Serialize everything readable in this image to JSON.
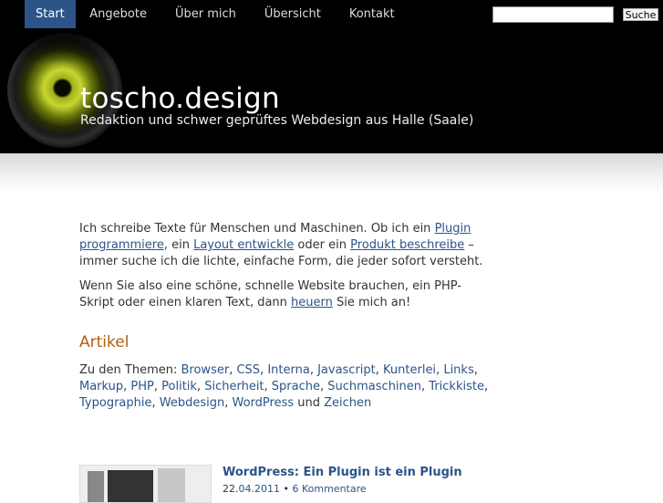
{
  "nav": {
    "items": [
      "Start",
      "Angebote",
      "Über mich",
      "Übersicht",
      "Kontakt"
    ]
  },
  "search": {
    "value": "",
    "button_label": "Suche"
  },
  "site": {
    "title": "toscho.design",
    "subtitle": "Redaktion und schwer geprüftes Webdesign aus Halle (Saale)"
  },
  "intro": {
    "p1_t1": "Ich schreibe Texte für Menschen und Maschinen. Ob ich ein ",
    "p1_l1": "Plugin programmiere",
    "p1_t2": ", ein ",
    "p1_l2": "Layout entwickle",
    "p1_t3": " oder ein ",
    "p1_l3": "Produkt beschreibe",
    "p1_t4": " – immer suche ich die lichte, einfache Form, die jeder sofort versteht.",
    "p2_t1": "Wenn Sie also eine schöne, schnelle Website brauchen, ein PHP-Skript oder einen klaren Text, dann ",
    "p2_l1": "heuern",
    "p2_t2": " Sie mich an!"
  },
  "articles": {
    "heading": "Artikel",
    "topics_label": "Zu den Themen: ",
    "topics": [
      "Browser",
      "CSS",
      "Interna",
      "Javascript",
      "Kunterlei",
      "Links",
      "Markup",
      "PHP",
      "Politik",
      "Sicherheit",
      "Sprache",
      "Suchmaschinen",
      "Trickkiste",
      "Typographie",
      "Webdesign",
      "WordPress",
      "Zeichen"
    ],
    "sep": ", ",
    "and": " und ",
    "first": {
      "title": "WordPress: Ein Plugin ist ein Plugin",
      "day": "22.",
      "month_year": "04.2011",
      "sep": " • ",
      "comments": "6 Kommentare"
    }
  }
}
